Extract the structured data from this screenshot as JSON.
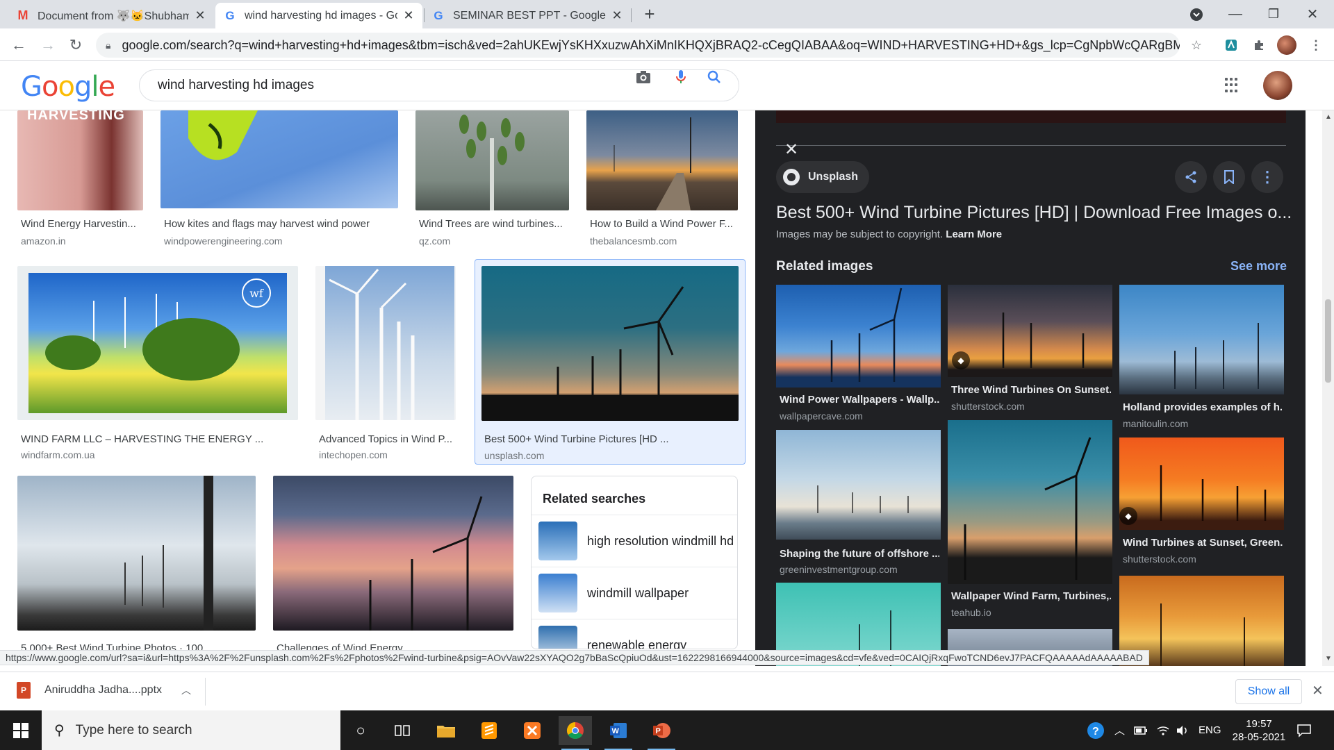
{
  "browser": {
    "tabs": [
      {
        "title": "Document from 🐺🐱Shubham🌈",
        "favicon": "gmail-icon",
        "active": false
      },
      {
        "title": "wind harvesting hd images - Goo",
        "favicon": "google-icon",
        "active": true
      },
      {
        "title": "SEMINAR BEST PPT - Google Sea",
        "favicon": "google-icon",
        "active": false
      }
    ],
    "new_tab": "+",
    "url": "google.com/search?q=wind+harvesting+hd+images&tbm=isch&ved=2ahUKEwjYsKHXxuzwAhXiMnIKHQXjBRAQ2-cCegQIABAA&oq=WIND+HARVESTING+HD+&gs_lcp=CgNpbWcQARgBMgQIl..."
  },
  "google": {
    "logo": [
      "G",
      "o",
      "o",
      "g",
      "l",
      "e"
    ],
    "query": "wind harvesting hd images"
  },
  "results": {
    "row1": [
      {
        "caption": "Wind Energy Harvestin...",
        "source": "amazon.in",
        "img_text": "HARVESTING"
      },
      {
        "caption": "How kites and flags may harvest wind power",
        "source": "windpowerengineering.com"
      },
      {
        "caption": "Wind Trees are wind turbines...",
        "source": "qz.com"
      },
      {
        "caption": "How to Build a Wind Power F...",
        "source": "thebalancesmb.com"
      }
    ],
    "row2": [
      {
        "caption": "WIND FARM LLC – HARVESTING THE ENERGY ...",
        "source": "windfarm.com.ua",
        "logo": "wf"
      },
      {
        "caption": "Advanced Topics in Wind P...",
        "source": "intechopen.com"
      },
      {
        "caption": "Best 500+ Wind Turbine Pictures [HD ...",
        "source": "unsplash.com"
      }
    ],
    "row3": [
      {
        "caption": "5,000+ Best Wind Turbine Photos · 100 ..."
      },
      {
        "caption": "Challenges of Wind Energy"
      }
    ],
    "related_searches": {
      "heading": "Related searches",
      "items": [
        "high resolution windmill hd",
        "windmill wallpaper",
        "renewable energy"
      ]
    }
  },
  "panel": {
    "source": "Unsplash",
    "title": "Best 500+ Wind Turbine Pictures [HD] | Download Free Images o...",
    "copyright_text": "Images may be subject to copyright.",
    "learn_more": "Learn More",
    "related_heading": "Related images",
    "see_more": "See more",
    "related": [
      {
        "caption": "Wind Power Wallpapers - Wallp...",
        "source": "wallpapercave.com"
      },
      {
        "caption": "Three Wind Turbines On Sunset...",
        "source": "shutterstock.com"
      },
      {
        "caption": "Holland provides examples of h...",
        "source": "manitoulin.com"
      },
      {
        "caption": "Shaping the future of offshore ...",
        "source": "greeninvestmentgroup.com"
      },
      {
        "caption": "Wallpaper Wind Farm, Turbines,...",
        "source": "teahub.io"
      },
      {
        "caption": "Wind Turbines at Sunset, Green...",
        "source": "shutterstock.com"
      }
    ]
  },
  "status_url": "https://www.google.com/url?sa=i&url=https%3A%2F%2Funsplash.com%2Fs%2Fphotos%2Fwind-turbine&psig=AOvVaw22sXYAQO2g7bBaScQpiuOd&ust=1622298166944000&source=images&cd=vfe&ved=0CAIQjRxqFwoTCND6evJ7PACFQAAAAAdAAAAABAD",
  "downloads": {
    "file": "Aniruddha Jadha....pptx",
    "show_all": "Show all"
  },
  "taskbar": {
    "search_placeholder": "Type here to search",
    "language": "ENG",
    "time": "19:57",
    "date": "28-05-2021"
  },
  "colors": {
    "google_blue": "#4285F4",
    "google_red": "#EA4335",
    "google_yellow": "#FBBC05",
    "google_green": "#34A853",
    "panel_bg": "#202124",
    "link_blue": "#8ab4f8"
  }
}
